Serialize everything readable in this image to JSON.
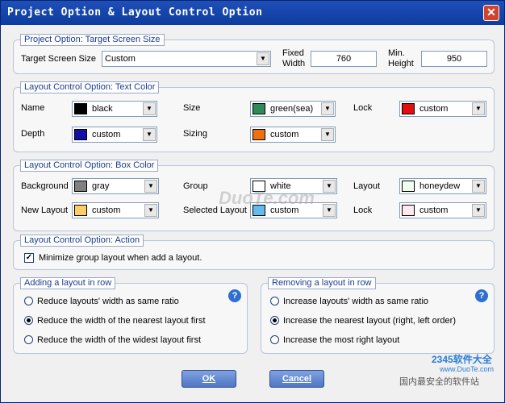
{
  "window": {
    "title": "Project Option & Layout Control Option",
    "close_label": "✕"
  },
  "project": {
    "legend": "Project Option: Target Screen Size",
    "target_label": "Target Screen Size",
    "target_value": "Custom",
    "fixed_width_label_1": "Fixed",
    "fixed_width_label_2": "Width",
    "fixed_width_value": "760",
    "min_height_label_1": "Min.",
    "min_height_label_2": "Height",
    "min_height_value": "950"
  },
  "text_color": {
    "legend": "Layout Control Option: Text Color",
    "name_label": "Name",
    "name_value": "black",
    "name_color": "#000000",
    "size_label": "Size",
    "size_value": "green(sea)",
    "size_color": "#2e8b57",
    "lock_label": "Lock",
    "lock_value": "custom",
    "lock_color": "#e01010",
    "depth_label": "Depth",
    "depth_value": "custom",
    "depth_color": "#1010a8",
    "sizing_label": "Sizing",
    "sizing_value": "custom",
    "sizing_color": "#f07010"
  },
  "box_color": {
    "legend": "Layout Control Option: Box Color",
    "background_label": "Background",
    "background_value": "gray",
    "background_color": "#808080",
    "group_label": "Group",
    "group_value": "white",
    "group_color": "#ffffff",
    "layout_label": "Layout",
    "layout_value": "honeydew",
    "layout_color": "#f0fff0",
    "new_layout_label": "New Layout",
    "new_layout_value": "custom",
    "new_layout_color": "#ffcc66",
    "selected_layout_label": "Selected Layout",
    "selected_layout_value": "custom",
    "selected_layout_color": "#66bbee",
    "lock_label": "Lock",
    "lock_value": "custom",
    "lock_color": "#ffe8f0"
  },
  "action": {
    "legend": "Layout Control Option: Action",
    "minimize_label": "Minimize group layout when add a layout.",
    "minimize_checked": "✓"
  },
  "adding": {
    "legend": "Adding a layout in row",
    "help": "?",
    "options": [
      "Reduce layouts' width as same ratio",
      "Reduce the width of the nearest layout first",
      "Reduce the width of the widest layout first"
    ]
  },
  "removing": {
    "legend": "Removing a layout in row",
    "help": "?",
    "options": [
      "Increase layouts' width as same ratio",
      "Increase the nearest layout (right, left order)",
      "Increase the most right layout"
    ]
  },
  "buttons": {
    "ok": "OK",
    "cancel": "Cancel"
  },
  "watermarks": {
    "center": "DuoTe.com",
    "brand": "2345软件大全",
    "site": "www.DuoTe.com",
    "slogan": "国内最安全的软件站"
  }
}
